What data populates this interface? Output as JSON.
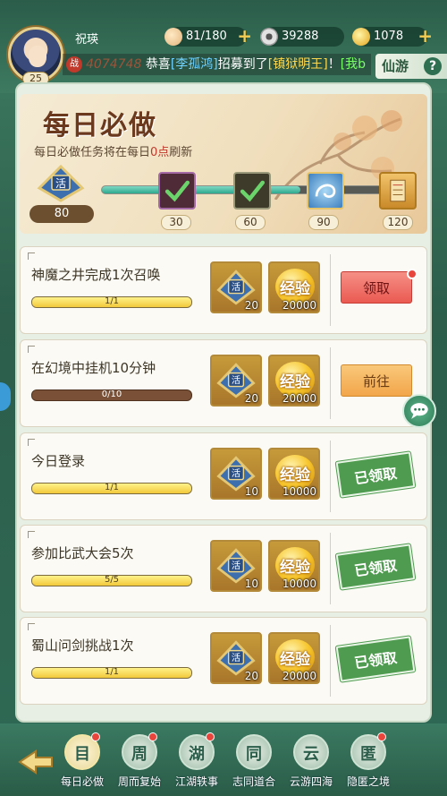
{
  "player": {
    "name": "祝瑛",
    "level": "25"
  },
  "resources": {
    "stamina": "81/180",
    "silver": "39288",
    "ingot": "1078"
  },
  "marquee": {
    "badge": "战",
    "ghost_text": "4074748",
    "prefix": "恭喜",
    "player": "[李孤鸿]",
    "middle": "招募到了",
    "item": "[镇狱明王]",
    "suffix": "！",
    "next": "[我b"
  },
  "xianyou_label": "仙游",
  "help_label": "?",
  "header": {
    "title": "每日必做",
    "subtitle_pre": "每日必做任务将在每日",
    "subtitle_hl": "0点",
    "subtitle_post": "刷新",
    "current_points": "80",
    "progress_fraction": 0.66,
    "milestones": [
      "30",
      "60",
      "90",
      "120"
    ]
  },
  "tasks": [
    {
      "name": "神魔之井完成1次召唤",
      "progress": "1/1",
      "token": "20",
      "exp_label": "经验",
      "exp": "20000",
      "button": "领取",
      "state": "claim"
    },
    {
      "name": "在幻境中挂机10分钟",
      "progress": "0/10",
      "token": "20",
      "exp_label": "经验",
      "exp": "20000",
      "button": "前往",
      "state": "go"
    },
    {
      "name": "今日登录",
      "progress": "1/1",
      "token": "10",
      "exp_label": "经验",
      "exp": "10000",
      "button": "已领取",
      "state": "done"
    },
    {
      "name": "参加比武大会5次",
      "progress": "5/5",
      "token": "10",
      "exp_label": "经验",
      "exp": "10000",
      "button": "已领取",
      "state": "done"
    },
    {
      "name": "蜀山问剑挑战1次",
      "progress": "1/1",
      "token": "20",
      "exp_label": "经验",
      "exp": "20000",
      "button": "已领取",
      "state": "done"
    }
  ],
  "nav": [
    {
      "label": "每日必做",
      "glyph": "目",
      "active": true
    },
    {
      "label": "周而复始",
      "glyph": "周",
      "active": false
    },
    {
      "label": "江湖轶事",
      "glyph": "湖",
      "active": false
    },
    {
      "label": "志同道合",
      "glyph": "同",
      "active": false
    },
    {
      "label": "云游四海",
      "glyph": "云",
      "active": false
    },
    {
      "label": "隐匿之境",
      "glyph": "匿",
      "active": false
    }
  ]
}
